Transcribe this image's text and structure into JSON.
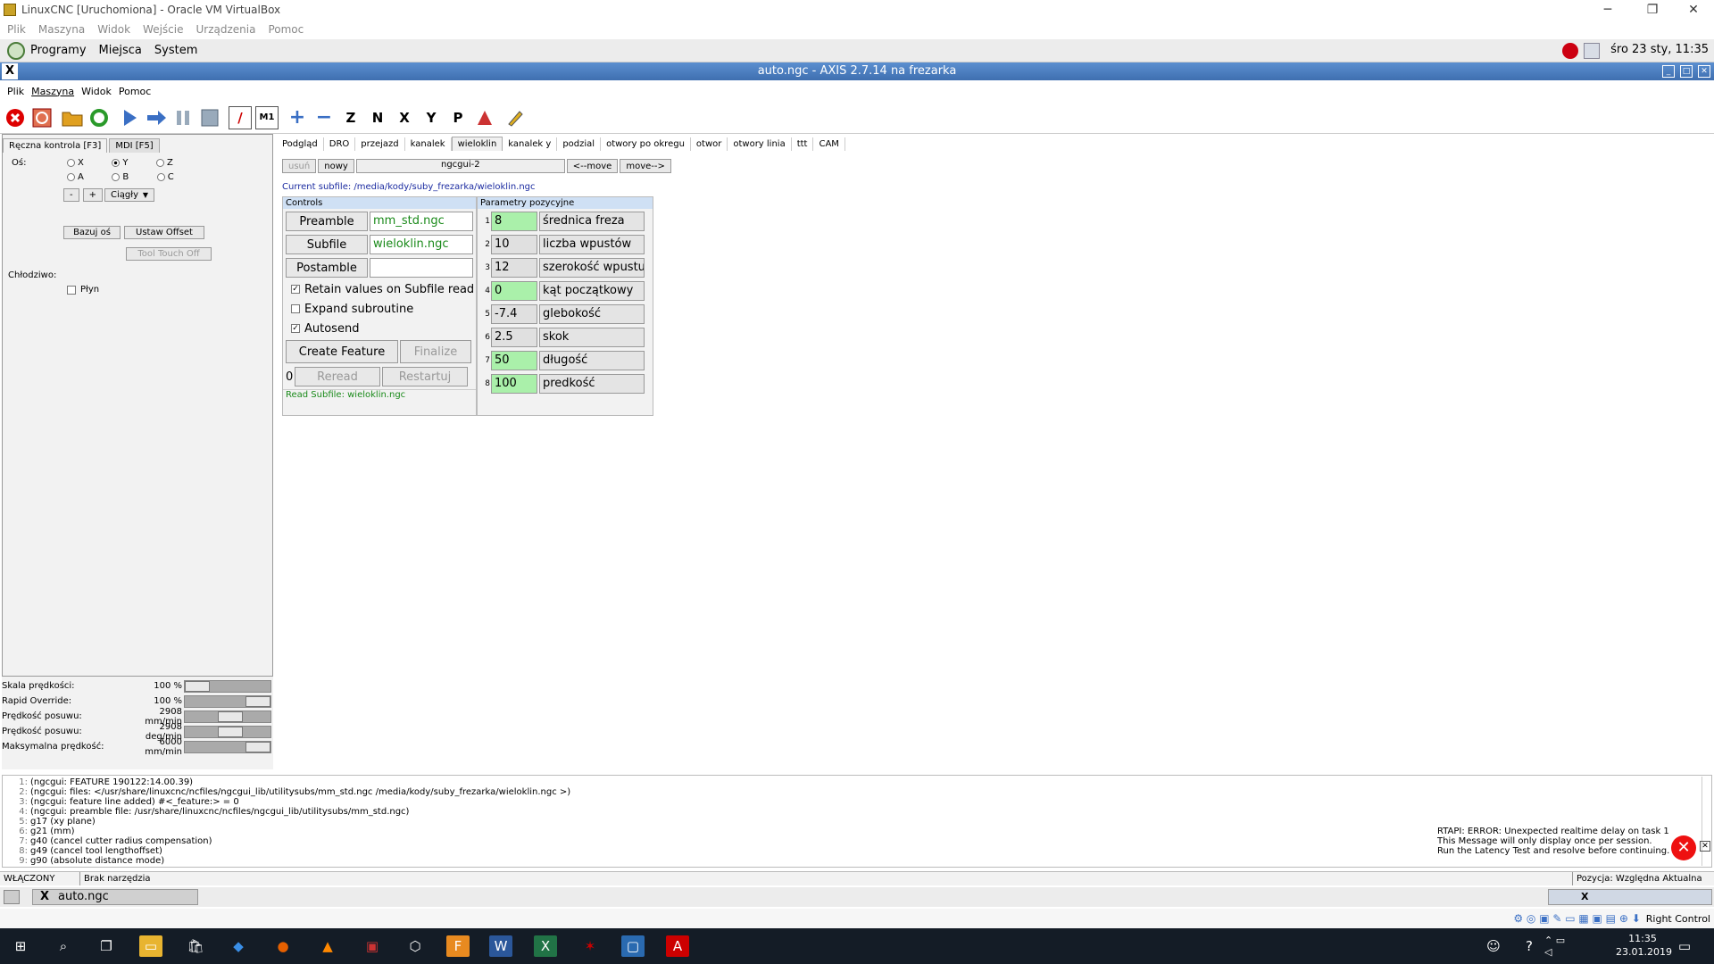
{
  "vb": {
    "title": "LinuxCNC [Uruchomiona] - Oracle VM VirtualBox",
    "menu": [
      "Plik",
      "Maszyna",
      "Widok",
      "Wejście",
      "Urządzenia",
      "Pomoc"
    ]
  },
  "gnome": {
    "menu": [
      "Programy",
      "Miejsca",
      "System"
    ],
    "clock": "śro 23 sty, 11:35"
  },
  "axis": {
    "title": "auto.ngc - AXIS 2.7.14 na frezarka",
    "menu": [
      "Plik",
      "Maszyna",
      "Widok",
      "Pomoc"
    ]
  },
  "left": {
    "tabs": [
      "Ręczna kontrola [F3]",
      "MDI [F5]"
    ],
    "axis_label": "Oś:",
    "axes": [
      "X",
      "Y",
      "Z",
      "A",
      "B",
      "C"
    ],
    "selected_axis": "Y",
    "minus": "-",
    "plus": "+",
    "mode": "Ciągły",
    "home_btn": "Bazuj oś",
    "offset_btn": "Ustaw Offset",
    "touch_btn": "Tool Touch Off",
    "coolant_label": "Chłodziwo:",
    "coolant_item": "Płyn"
  },
  "sliders": [
    {
      "name": "Skala prędkości:",
      "value": "100 %",
      "pos": 0.0
    },
    {
      "name": "Rapid Override:",
      "value": "100 %",
      "pos": 1.0
    },
    {
      "name": "Prędkość posuwu:",
      "value": "2908 mm/min",
      "pos": 0.55
    },
    {
      "name": "Prędkość posuwu:",
      "value": "2908 deg/min",
      "pos": 0.55
    },
    {
      "name": "Maksymalna prędkość:",
      "value": "6000 mm/min",
      "pos": 1.0
    }
  ],
  "ftabs": [
    "Podgląd",
    "DRO",
    "przejazd",
    "kanalek",
    "wieloklin",
    "kanalek y",
    "podzial",
    "otwory po okregu",
    "otwor",
    "otwory linia",
    "ttt",
    "CAM"
  ],
  "ngc": {
    "usun": "usuń",
    "nowy": "nowy",
    "name": "ngcgui-2",
    "move_left": "<--move",
    "move_right": "move-->",
    "current": "Current subfile: /media/kody/suby_frezarka/wieloklin.ngc",
    "controls_hdr": "Controls",
    "params_hdr": "Parametry pozycyjne",
    "preamble_btn": "Preamble",
    "preamble_val": "mm_std.ngc",
    "subfile_btn": "Subfile",
    "subfile_val": "wieloklin.ngc",
    "postamble_btn": "Postamble",
    "postamble_val": "",
    "retain": "Retain values on Subfile read",
    "expand": "Expand subroutine",
    "autosend": "Autosend",
    "create": "Create Feature",
    "finalize": "Finalize",
    "count": "0",
    "reread": "Reread",
    "restart": "Restartuj",
    "read_msg": "Read Subfile: wieloklin.ngc"
  },
  "params": [
    {
      "n": "1",
      "v": "8",
      "l": "średnica freza",
      "c": "g"
    },
    {
      "n": "2",
      "v": "10",
      "l": "liczba wpustów",
      "c": "w"
    },
    {
      "n": "3",
      "v": "12",
      "l": "szerokość wpustu",
      "c": "w"
    },
    {
      "n": "4",
      "v": "0",
      "l": "kąt początkowy",
      "c": "g"
    },
    {
      "n": "5",
      "v": "-7.4",
      "l": "glebokość",
      "c": "w"
    },
    {
      "n": "6",
      "v": "2.5",
      "l": "skok",
      "c": "w"
    },
    {
      "n": "7",
      "v": "50",
      "l": "długość",
      "c": "g"
    },
    {
      "n": "8",
      "v": "100",
      "l": "predkość",
      "c": "g"
    }
  ],
  "log": [
    "(ngcgui: FEATURE 190122:14.00.39)",
    "(ngcgui: files: </usr/share/linuxcnc/ncfiles/ngcgui_lib/utilitysubs/mm_std.ngc /media/kody/suby_frezarka/wieloklin.ngc >)",
    "(ngcgui: feature line added) #<_feature:> = 0",
    "(ngcgui: preamble file: /usr/share/linuxcnc/ncfiles/ngcgui_lib/utilitysubs/mm_std.ngc)",
    "g17 (xy plane)",
    "g21 (mm)",
    "g40 (cancel cutter radius compensation)",
    "g49 (cancel tool lengthoffset)",
    "g90 (absolute distance mode)"
  ],
  "rtapi": [
    "RTAPI: ERROR: Unexpected realtime delay on task 1",
    "This Message will only display once per session.",
    "Run the Latency Test and resolve before continuing."
  ],
  "status": {
    "state": "WŁĄCZONY",
    "tool": "Brak narzędzia",
    "pos": "Pozycja: Względna Aktualna"
  },
  "task": {
    "item": "auto.ngc"
  },
  "vbstat": {
    "host_key": "Right Control"
  },
  "win": {
    "time": "11:35",
    "date": "23.01.2019"
  }
}
